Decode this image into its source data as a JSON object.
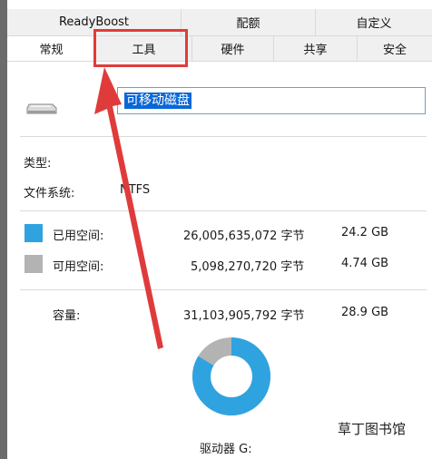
{
  "tabs_row1": [
    "ReadyBoost",
    "配额",
    "自定义"
  ],
  "tabs_row2": [
    "常规",
    "工具",
    "硬件",
    "共享",
    "安全"
  ],
  "drive_name": "可移动磁盘",
  "type_label": "类型:",
  "fs_label": "文件系统:",
  "fs_value": "NTFS",
  "used": {
    "label": "已用空间:",
    "bytes": "26,005,635,072 字节",
    "size": "24.2 GB",
    "color": "#2ea3e0"
  },
  "free": {
    "label": "可用空间:",
    "bytes": "5,098,270,720 字节",
    "size": "4.74 GB",
    "color": "#b3b3b3"
  },
  "capacity": {
    "label": "容量:",
    "bytes": "31,103,905,792 字节",
    "size": "28.9 GB"
  },
  "drive_label": "驱动器 G:",
  "watermark": "草丁图书馆",
  "usage_fraction": 0.836
}
